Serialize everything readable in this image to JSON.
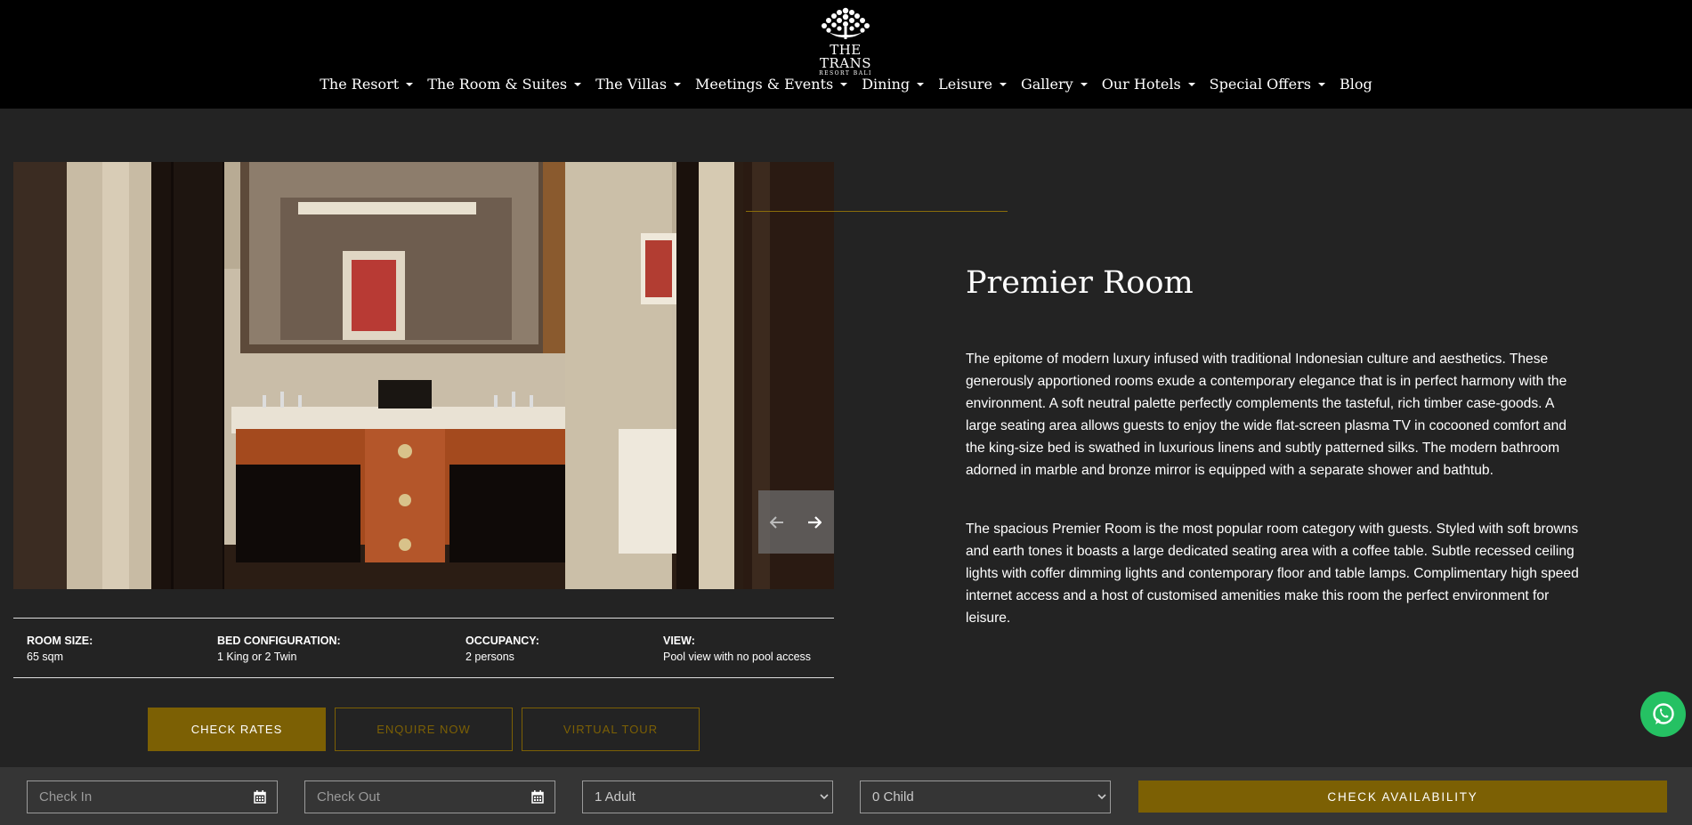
{
  "brand": {
    "title": "THE TRANS",
    "subtitle": "RESORT BALI"
  },
  "nav": [
    {
      "label": "The Resort",
      "dropdown": true
    },
    {
      "label": "The Room & Suites",
      "dropdown": true
    },
    {
      "label": "The Villas",
      "dropdown": true
    },
    {
      "label": "Meetings & Events",
      "dropdown": true
    },
    {
      "label": "Dining",
      "dropdown": true
    },
    {
      "label": "Leisure",
      "dropdown": true
    },
    {
      "label": "Gallery",
      "dropdown": true
    },
    {
      "label": "Our Hotels",
      "dropdown": true
    },
    {
      "label": "Special Offers",
      "dropdown": true
    },
    {
      "label": "Blog",
      "dropdown": false
    }
  ],
  "room": {
    "title": "Premier Room",
    "description": [
      "The epitome of modern luxury infused with traditional Indonesian culture and aesthetics. These generously apportioned rooms exude a contemporary elegance that is in perfect harmony with the environment. A soft neutral palette perfectly complements the tasteful, rich timber case-goods. A large seating area allows guests to enjoy the wide flat-screen plasma TV in cocooned comfort and the king-size bed is swathed in luxurious linens and subtly patterned silks. The modern bathroom adorned in marble and bronze mirror is equipped with a separate shower and bathtub.",
      "The spacious Premier Room is the most popular room category with guests. Styled with soft browns and earth tones it boasts a large dedicated seating area with a coffee table. Subtle recessed ceiling lights with coffer dimming lights and contemporary floor and table lamps. Complimentary high speed internet access and a host of customised amenities make this room the perfect environment for leisure."
    ],
    "specs": {
      "size": {
        "label": "ROOM SIZE:",
        "value": "65 sqm"
      },
      "bed": {
        "label": "BED CONFIGURATION:",
        "value": "1 King or 2 Twin"
      },
      "occupancy": {
        "label": "OCCUPANCY:",
        "value": "2 persons"
      },
      "view": {
        "label": "VIEW:",
        "value": "Pool view with no pool access"
      }
    }
  },
  "actions": {
    "check_rates": "CHECK RATES",
    "enquire": "ENQUIRE NOW",
    "virtual_tour": "VIRTUAL TOUR"
  },
  "booking": {
    "check_in_placeholder": "Check In",
    "check_out_placeholder": "Check Out",
    "adults": "1 Adult",
    "children": "0 Child",
    "submit": "CHECK AVAILABILITY"
  },
  "icons": {
    "whatsapp": "whatsapp-icon",
    "calendar": "calendar-icon",
    "prev": "arrow-left-icon",
    "next": "arrow-right-icon"
  },
  "colors": {
    "gold": "#7c6004",
    "header_bg": "#000000",
    "page_bg": "#232323",
    "booking_bg": "#353535",
    "whatsapp": "#25c163"
  }
}
